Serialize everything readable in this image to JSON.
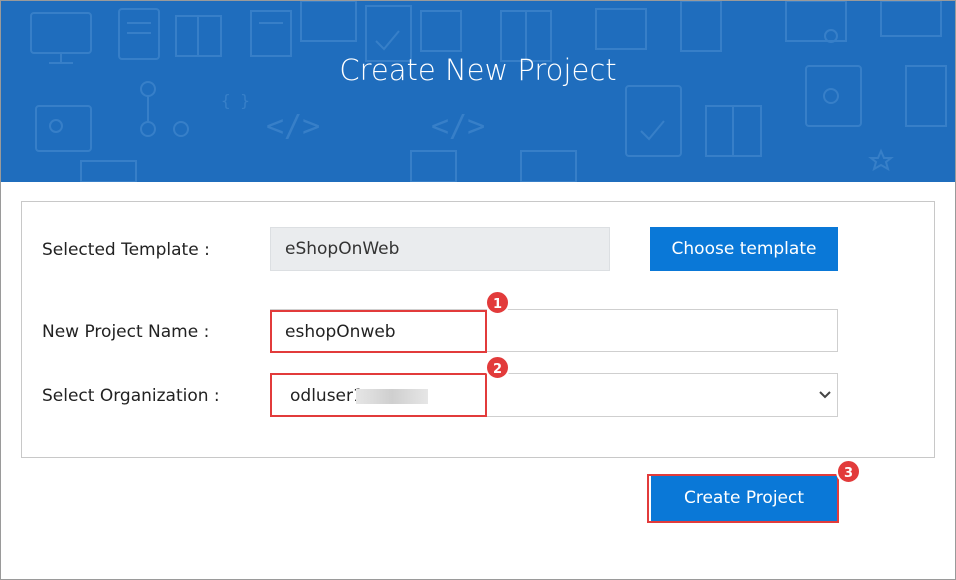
{
  "header": {
    "title": "Create New Project"
  },
  "form": {
    "selected_template_label": "Selected Template :",
    "selected_template_value": "eShopOnWeb",
    "choose_template_label": "Choose template",
    "project_name_label": "New Project Name :",
    "project_name_value": "eshopOnweb",
    "organization_label": "Select Organization :",
    "organization_value": "odluser1",
    "create_project_label": "Create Project"
  },
  "annotations": {
    "step1": "1",
    "step2": "2",
    "step3": "3"
  },
  "colors": {
    "header_bg": "#1f6dbd",
    "button_bg": "#0a78d7",
    "highlight": "#e23b3b"
  },
  "icons": {
    "select_arrow": "chevron-down-icon"
  }
}
